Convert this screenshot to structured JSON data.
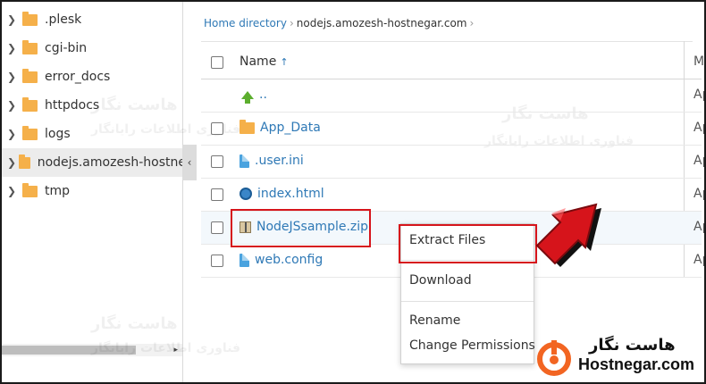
{
  "tree": {
    "items": [
      {
        "label": ".plesk"
      },
      {
        "label": "cgi-bin"
      },
      {
        "label": "error_docs"
      },
      {
        "label": "httpdocs"
      },
      {
        "label": "logs"
      },
      {
        "label": "nodejs.amozesh-hostnegar.com"
      },
      {
        "label": "tmp"
      }
    ],
    "collapse_glyph": "‹",
    "scroll_arrow": "▸"
  },
  "breadcrumb": {
    "home": "Home directory",
    "separator": "›",
    "current": "nodejs.amozesh-hostnegar.com",
    "trail_sep": "›"
  },
  "table": {
    "name_header": "Name",
    "sort_glyph": "↑",
    "modified_header": "Me",
    "rows": [
      {
        "name": "..",
        "icon": "up-arrow-icon",
        "modified": "Ap"
      },
      {
        "name": "App_Data",
        "icon": "folder-icon",
        "modified": "Ap"
      },
      {
        "name": ".user.ini",
        "icon": "file-icon",
        "modified": "Ap"
      },
      {
        "name": "index.html",
        "icon": "html-file-icon",
        "modified": "Ap"
      },
      {
        "name": "NodeJSsample.zip",
        "icon": "zip-file-icon",
        "modified": "Ap"
      },
      {
        "name": "web.config",
        "icon": "file-icon",
        "modified": "Ap"
      }
    ]
  },
  "context_menu": {
    "extract": "Extract Files",
    "download": "Download",
    "rename": "Rename",
    "permissions": "Change Permissions"
  },
  "watermark": {
    "line1": "هاست نگار",
    "line2": "فناوری اطلاعات رایانگار"
  },
  "logo": {
    "fa": "هاست نگار",
    "en": "Hostnegar.com"
  },
  "colors": {
    "link": "#2f79b6",
    "highlight": "#d6141b",
    "folder": "#f5b04a"
  }
}
